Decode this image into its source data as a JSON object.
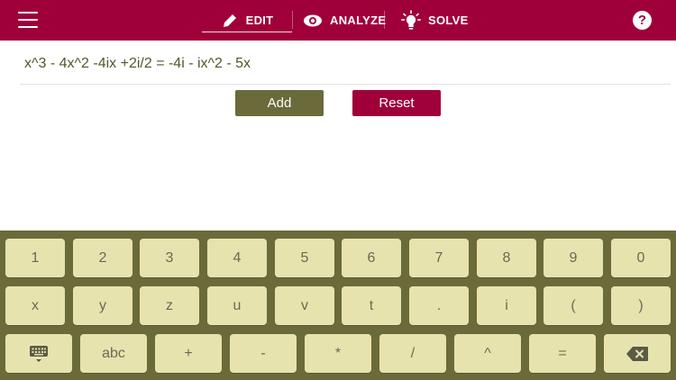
{
  "nav": {
    "edit_label": "EDIT",
    "analyze_label": "ANALYZE",
    "solve_label": "SOLVE",
    "help_label": "?"
  },
  "equation": {
    "text": "x^3 - 4x^2 -4ix +2i/2 = -4i - ix^2 - 5x"
  },
  "actions": {
    "add_label": "Add",
    "reset_label": "Reset"
  },
  "keyboard": {
    "row1": [
      "1",
      "2",
      "3",
      "4",
      "5",
      "6",
      "7",
      "8",
      "9",
      "0"
    ],
    "row2": [
      "x",
      "y",
      "z",
      "u",
      "v",
      "t",
      ".",
      "i",
      "(",
      ")"
    ],
    "row3": [
      "abc",
      "+",
      "-",
      "*",
      "/",
      "^",
      "="
    ]
  },
  "colors": {
    "brand": "#a0003a",
    "olive": "#6b6a3a",
    "key_bg": "#e7e3ae"
  },
  "icons": [
    "menu-icon",
    "pencil-icon",
    "eye-icon",
    "lightbulb-icon",
    "help-icon",
    "keyboard-icon",
    "backspace-icon"
  ]
}
